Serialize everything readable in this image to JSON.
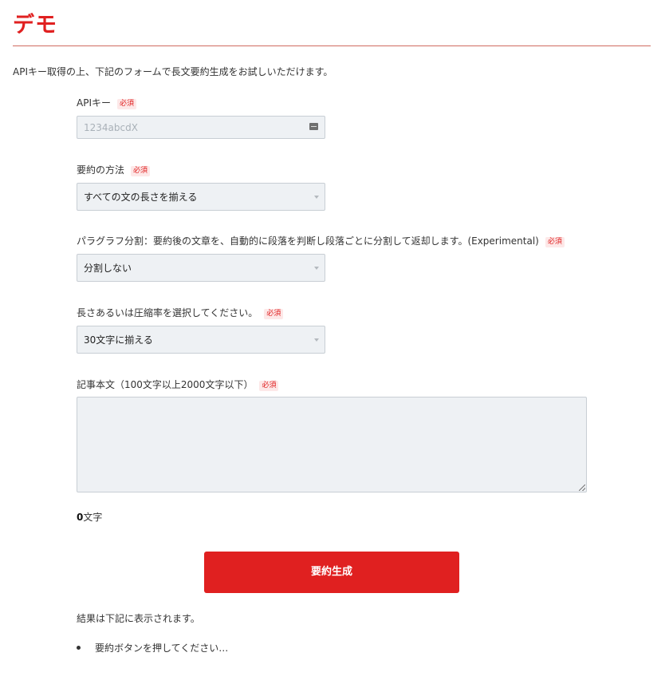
{
  "page": {
    "title": "デモ",
    "intro": "APIキー取得の上、下記のフォームで長文要約生成をお試しいただけます。"
  },
  "required_badge": "必須",
  "fields": {
    "api_key": {
      "label": "APIキー",
      "placeholder": "1234abcdX",
      "icon": "key-card-icon"
    },
    "method": {
      "label": "要約の方法",
      "value": "すべての文の長さを揃える"
    },
    "paragraph": {
      "label": "パラグラフ分割：要約後の文章を、自動的に段落を判断し段落ごとに分割して返却します。(Experimental)",
      "value": "分割しない"
    },
    "length": {
      "label": "長さあるいは圧縮率を選択してください。",
      "value": "30文字に揃える"
    },
    "article": {
      "label": "記事本文（100文字以上2000文字以下）",
      "value": ""
    }
  },
  "counter": {
    "count": "0",
    "unit": "文字"
  },
  "submit_label": "要約生成",
  "result": {
    "note": "結果は下記に表示されます。",
    "items": [
      "要約ボタンを押してください…"
    ]
  },
  "colors": {
    "accent": "#e02020",
    "input_bg": "#eef1f4",
    "input_border": "#c8ced4"
  }
}
